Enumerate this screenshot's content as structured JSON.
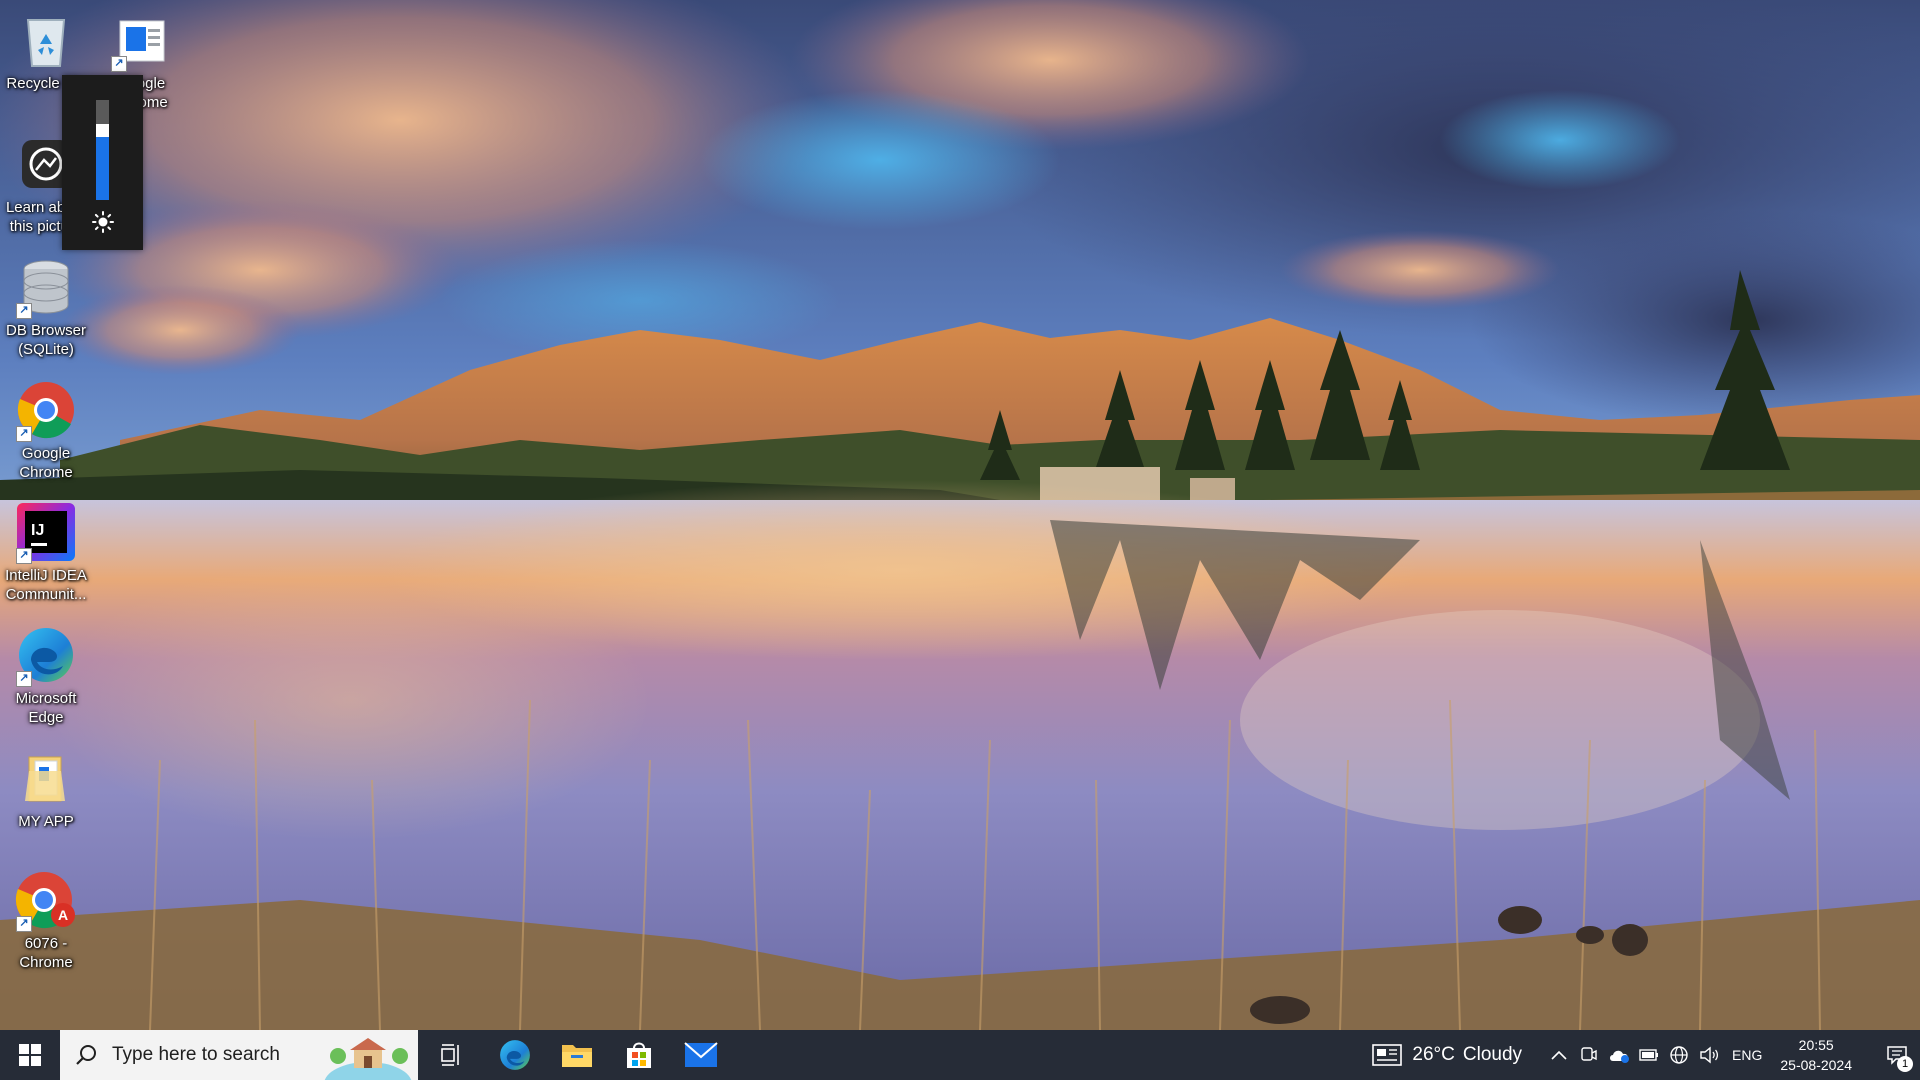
{
  "desktop": {
    "icons": [
      {
        "label": "Recycle Bin",
        "icon": "recycle-bin-icon"
      },
      {
        "label": "Google\nChrome",
        "icon": "google-docs-shortcut-icon"
      },
      {
        "label": "Learn about\nthis picture",
        "icon": "learn-about-picture-icon"
      },
      {
        "label": "DB Browser\n(SQLite)",
        "icon": "database-icon"
      },
      {
        "label": "Google\nChrome",
        "icon": "chrome-icon"
      },
      {
        "label": "IntelliJ IDEA\nCommunit...",
        "icon": "intellij-icon"
      },
      {
        "label": "Microsoft\nEdge",
        "icon": "edge-icon"
      },
      {
        "label": "MY APP",
        "icon": "folder-icon"
      },
      {
        "label": "6076 -\nChrome",
        "icon": "chrome-profile-icon"
      }
    ],
    "profile_badge": "A",
    "intellij_mark": "IJ"
  },
  "brightness": {
    "level": 0.72,
    "icon": "sun-icon"
  },
  "taskbar": {
    "start_icon": "windows-logo-icon",
    "search_placeholder": "Type here to search",
    "apps": [
      {
        "name": "Task View",
        "icon": "task-view-icon"
      },
      {
        "name": "Microsoft Edge",
        "icon": "edge-icon"
      },
      {
        "name": "File Explorer",
        "icon": "file-explorer-icon"
      },
      {
        "name": "Microsoft Store",
        "icon": "store-icon"
      },
      {
        "name": "Mail",
        "icon": "mail-icon"
      }
    ],
    "weather": {
      "temp": "26°C",
      "condition": "Cloudy"
    },
    "tray_icons": [
      "chevron-up-icon",
      "meet-now-icon",
      "onedrive-icon",
      "battery-icon",
      "network-icon",
      "speaker-icon"
    ],
    "language": "ENG",
    "time": "20:55",
    "date": "25-08-2024",
    "notification_count": "1"
  },
  "colors": {
    "accent": "#1a73e8",
    "taskbar": "#141a26",
    "search_bg": "#f3f3f3"
  }
}
